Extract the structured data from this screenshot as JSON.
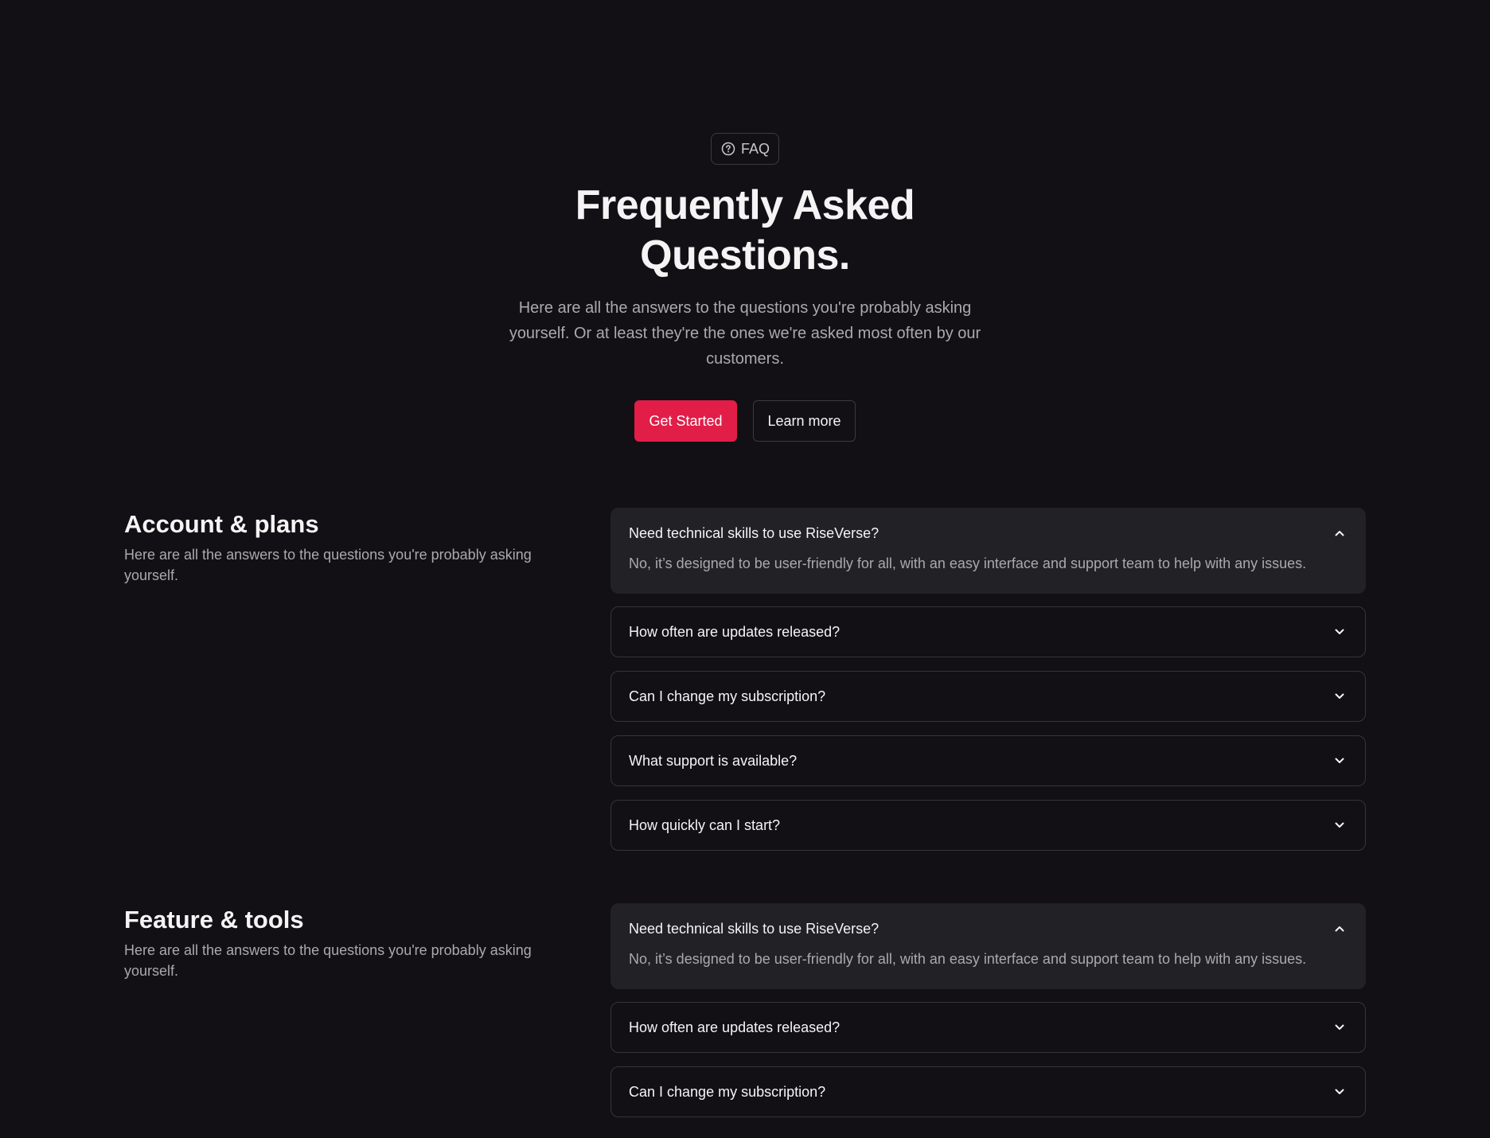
{
  "hero": {
    "badge_label": "FAQ",
    "title": "Frequently Asked Questions.",
    "description": "Here are all the answers to the questions you're probably asking yourself. Or at least they're the ones we're asked most often by our customers.",
    "primary_button": "Get Started",
    "secondary_button": "Learn more"
  },
  "colors": {
    "background": "#121014",
    "accent": "#e11d48",
    "panel": "#222126",
    "border": "#34343a"
  },
  "sections": [
    {
      "title": "Account & plans",
      "description": "Here are all the answers to the questions you're probably asking yourself.",
      "items": [
        {
          "question": "Need technical skills to use RiseVerse?",
          "answer": "No, it’s designed to be user-friendly for all, with an easy interface and support team to help with any issues.",
          "expanded": true,
          "icon": "chevron-up-icon"
        },
        {
          "question": "How often are updates released?",
          "expanded": false,
          "icon": "chevron-down-icon"
        },
        {
          "question": "Can I change my subscription?",
          "expanded": false,
          "icon": "chevron-down-icon"
        },
        {
          "question": "What support is available?",
          "expanded": false,
          "icon": "chevron-down-icon"
        },
        {
          "question": "How quickly can I start?",
          "expanded": false,
          "icon": "chevron-down-icon"
        }
      ]
    },
    {
      "title": "Feature & tools",
      "description": "Here are all the answers to the questions you're probably asking yourself.",
      "items": [
        {
          "question": "Need technical skills to use RiseVerse?",
          "answer": "No, it’s designed to be user-friendly for all, with an easy interface and support team to help with any issues.",
          "expanded": true,
          "icon": "chevron-up-icon"
        },
        {
          "question": "How often are updates released?",
          "expanded": false,
          "icon": "chevron-down-icon"
        },
        {
          "question": "Can I change my subscription?",
          "expanded": false,
          "icon": "chevron-down-icon"
        }
      ]
    }
  ]
}
